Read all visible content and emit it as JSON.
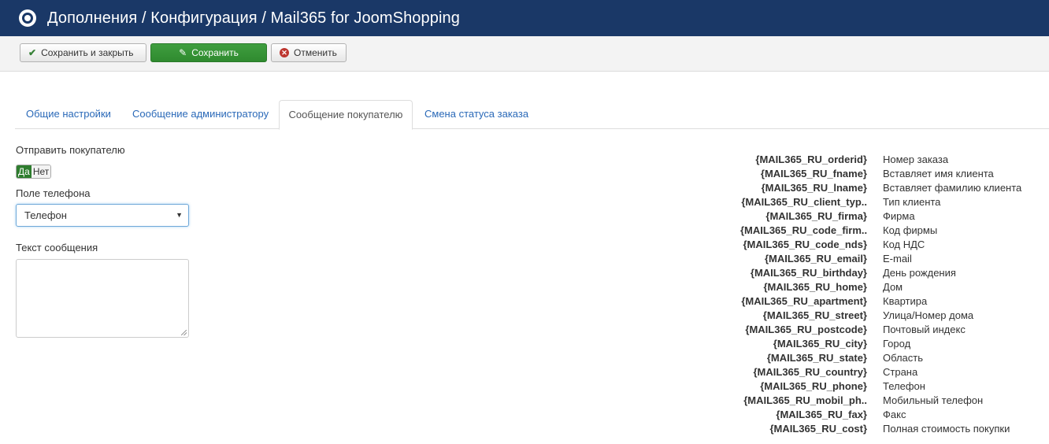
{
  "header": {
    "title": "Дополнения / Конфигурация / Mail365 for JoomShopping",
    "icon": "target-icon"
  },
  "toolbar": {
    "save_close_label": "Сохранить и закрыть",
    "save_label": "Сохранить",
    "cancel_label": "Отменить"
  },
  "tabs": [
    {
      "label": "Общие настройки"
    },
    {
      "label": "Сообщение администратору"
    },
    {
      "label": "Сообщение покупателю",
      "active": true
    },
    {
      "label": "Смена статуса заказа"
    }
  ],
  "form": {
    "send_label": "Отправить покупателю",
    "toggle_yes": "Да",
    "toggle_no": "Нет",
    "phone_label": "Поле телефона",
    "phone_value": "Телефон",
    "text_label": "Текст сообщения",
    "text_value": ""
  },
  "tags": [
    {
      "key": "{MAIL365_RU_orderid}",
      "desc": "Номер заказа"
    },
    {
      "key": "{MAIL365_RU_fname}",
      "desc": "Вставляет имя клиента"
    },
    {
      "key": "{MAIL365_RU_lname}",
      "desc": "Вставляет фамилию клиента"
    },
    {
      "key": "{MAIL365_RU_client_typ..",
      "desc": "Тип клиента"
    },
    {
      "key": "{MAIL365_RU_firma}",
      "desc": "Фирма"
    },
    {
      "key": "{MAIL365_RU_code_firm..",
      "desc": "Код фирмы"
    },
    {
      "key": "{MAIL365_RU_code_nds}",
      "desc": "Код НДС"
    },
    {
      "key": "{MAIL365_RU_email}",
      "desc": "E-mail"
    },
    {
      "key": "{MAIL365_RU_birthday}",
      "desc": "День рождения"
    },
    {
      "key": "{MAIL365_RU_home}",
      "desc": "Дом"
    },
    {
      "key": "{MAIL365_RU_apartment}",
      "desc": "Квартира"
    },
    {
      "key": "{MAIL365_RU_street}",
      "desc": "Улица/Номер дома"
    },
    {
      "key": "{MAIL365_RU_postcode}",
      "desc": "Почтовый индекс"
    },
    {
      "key": "{MAIL365_RU_city}",
      "desc": "Город"
    },
    {
      "key": "{MAIL365_RU_state}",
      "desc": "Область"
    },
    {
      "key": "{MAIL365_RU_country}",
      "desc": "Страна"
    },
    {
      "key": "{MAIL365_RU_phone}",
      "desc": "Телефон"
    },
    {
      "key": "{MAIL365_RU_mobil_ph..",
      "desc": "Мобильный телефон"
    },
    {
      "key": "{MAIL365_RU_fax}",
      "desc": "Факс"
    },
    {
      "key": "{MAIL365_RU_cost}",
      "desc": "Полная стоимость покупки"
    }
  ]
}
